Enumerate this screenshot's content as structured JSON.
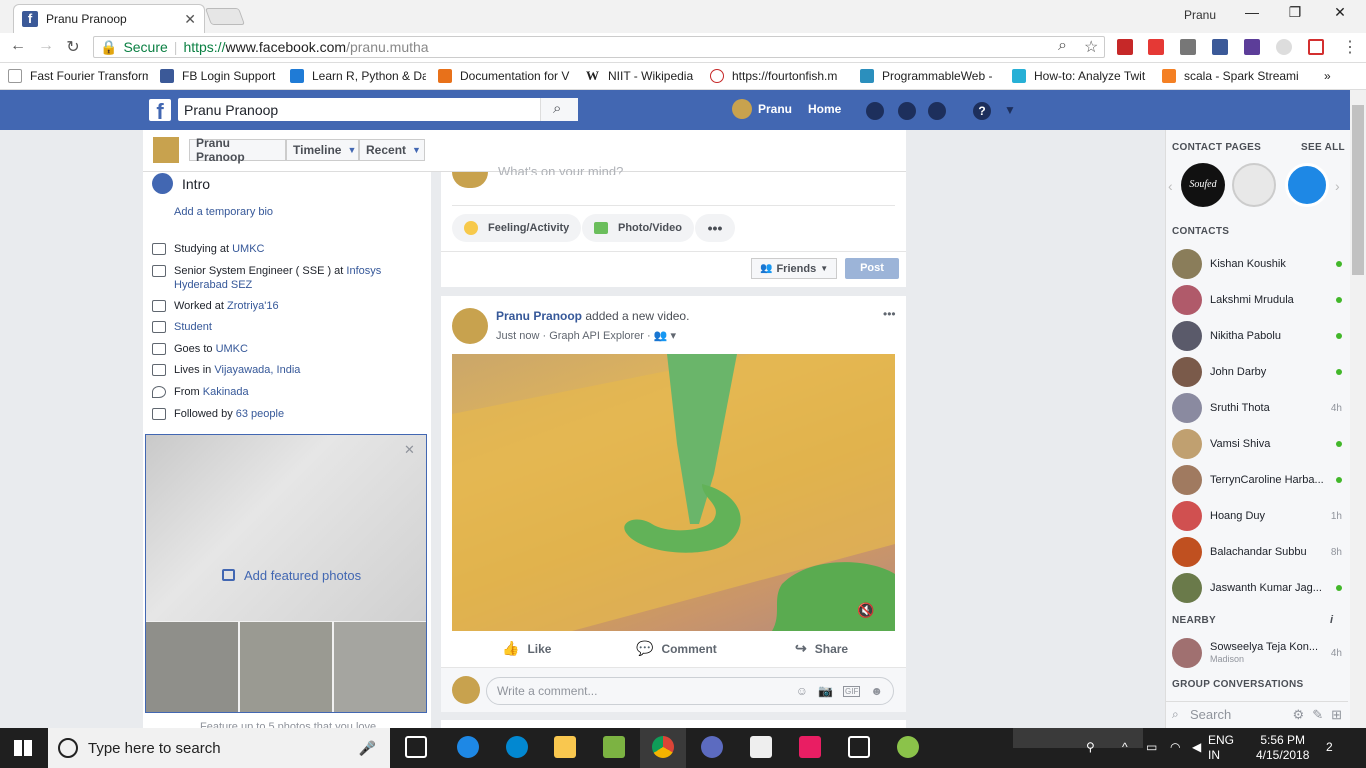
{
  "browser": {
    "tab_title": "Pranu Pranoop",
    "window_user": "Pranu",
    "secure_label": "Secure",
    "url_scheme": "https://",
    "url_host": "www.facebook.com",
    "url_path": "/pranu.mutha",
    "bookmarks": [
      {
        "label": "Fast Fourier Transform",
        "color": "#555555"
      },
      {
        "label": "FB Login Support",
        "color": "#3b5998"
      },
      {
        "label": "Learn R, Python & Da",
        "color": "#1f7bd6"
      },
      {
        "label": "Documentation for V",
        "color": "#e8711a"
      },
      {
        "label": "NIIT - Wikipedia",
        "color": "#222222"
      },
      {
        "label": "https://fourtonfish.m",
        "color": "#c62828"
      },
      {
        "label": "ProgrammableWeb -",
        "color": "#2b8fbd"
      },
      {
        "label": "How-to: Analyze Twit",
        "color": "#27b0d6"
      },
      {
        "label": "scala - Spark Streami",
        "color": "#f48024"
      }
    ]
  },
  "fb": {
    "search_value": "Pranu Pranoop",
    "user_name": "Pranu",
    "home_label": "Home",
    "sticky_name": "Pranu Pranoop",
    "timeline_label": "Timeline",
    "recent_label": "Recent"
  },
  "intro": {
    "title": "Intro",
    "add_bio": "Add a temporary bio",
    "items": [
      {
        "text": "Studying at ",
        "link": "UMKC"
      },
      {
        "text": "Senior System Engineer ( SSE ) at ",
        "link": "Infosys Hyderabad SEZ"
      },
      {
        "text": "Worked at ",
        "link": "Zrotriya'16"
      },
      {
        "text": "",
        "link": "Student"
      },
      {
        "text": "Goes to ",
        "link": "UMKC"
      },
      {
        "text": "Lives in ",
        "link": "Vijayawada, India"
      },
      {
        "text": "From ",
        "link": "Kakinada"
      },
      {
        "text": "Followed by ",
        "link": "63 people"
      }
    ],
    "featured_link": "Add featured photos",
    "featured_caption": "Feature up to 5 photos that you love"
  },
  "composer": {
    "placeholder": "What's on your mind?",
    "feeling": "Feeling/Activity",
    "photo": "Photo/Video",
    "audience": "Friends",
    "post": "Post"
  },
  "post": {
    "author": "Pranu Pranoop",
    "action": " added a new video.",
    "time": "Just now",
    "via": " · Graph API Explorer · ",
    "like": "Like",
    "comment": "Comment",
    "share": "Share",
    "comment_placeholder": "Write a comment..."
  },
  "sidebar": {
    "contact_pages": "CONTACT PAGES",
    "see_all": "SEE ALL",
    "contacts_label": "CONTACTS",
    "contacts": [
      {
        "name": "Kishan Koushik",
        "status": "online",
        "time": "",
        "color": "#8a7d5a"
      },
      {
        "name": "Lakshmi Mrudula",
        "status": "online",
        "time": "",
        "color": "#b05a6a"
      },
      {
        "name": "Nikitha Pabolu",
        "status": "online",
        "time": "",
        "color": "#5a5a6a"
      },
      {
        "name": "John Darby",
        "status": "online",
        "time": "",
        "color": "#7a5a4a"
      },
      {
        "name": "Sruthi Thota",
        "status": "idle",
        "time": "4h",
        "color": "#8a8aa0"
      },
      {
        "name": "Vamsi Shiva",
        "status": "online",
        "time": "",
        "color": "#c0a070"
      },
      {
        "name": "TerrynCaroline Harba...",
        "status": "online",
        "time": "",
        "color": "#a07a60"
      },
      {
        "name": "Hoang Duy",
        "status": "idle",
        "time": "1h",
        "color": "#d05050"
      },
      {
        "name": "Balachandar Subbu",
        "status": "idle",
        "time": "8h",
        "color": "#c05020"
      },
      {
        "name": "Jaswanth Kumar Jag...",
        "status": "online",
        "time": "",
        "color": "#6a7a4a"
      }
    ],
    "nearby_label": "NEARBY",
    "nearby": {
      "name": "Sowseelya Teja Kon...",
      "sub": "Madison",
      "time": "4h"
    },
    "group_label": "GROUP CONVERSATIONS",
    "search_placeholder": "Search"
  },
  "taskbar": {
    "search_placeholder": "Type here to search",
    "lang": "ENG",
    "region": "IN",
    "time": "5:56 PM",
    "date": "4/15/2018",
    "notif_count": "2"
  },
  "colors": {
    "fb_blue": "#4267b2",
    "link": "#365899",
    "online": "#42b72a"
  }
}
